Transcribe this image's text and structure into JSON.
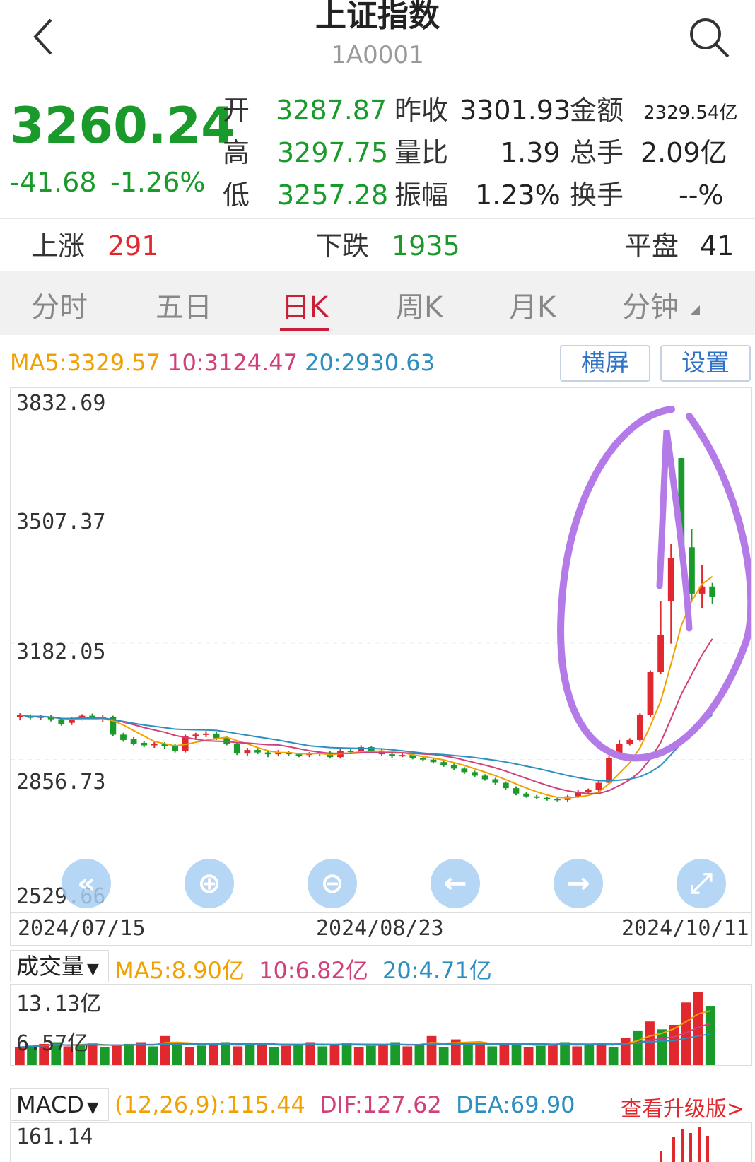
{
  "header": {
    "title": "上证指数",
    "code": "1A0001",
    "back_icon": "chevron-left-icon",
    "search_icon": "search-icon"
  },
  "quote": {
    "price": "3260.24",
    "change": "-41.68",
    "change_pct": "-1.26%",
    "open_label": "开",
    "open": "3287.87",
    "high_label": "高",
    "high": "3297.75",
    "low_label": "低",
    "low": "3257.28",
    "prev_close_label": "昨收",
    "prev_close": "3301.93",
    "vol_ratio_label": "量比",
    "vol_ratio": "1.39",
    "amplitude_label": "振幅",
    "amplitude": "1.23%",
    "amount_label": "金额",
    "amount": "2329.54亿",
    "total_hand_label": "总手",
    "total_hand": "2.09亿",
    "turnover_label": "换手",
    "turnover": "--%"
  },
  "breadth": {
    "up_label": "上涨",
    "up": "291",
    "down_label": "下跌",
    "down": "1935",
    "flat_label": "平盘",
    "flat": "41"
  },
  "tabs": [
    {
      "label": "分时"
    },
    {
      "label": "五日"
    },
    {
      "label": "日K"
    },
    {
      "label": "周K"
    },
    {
      "label": "月K"
    },
    {
      "label": "分钟"
    }
  ],
  "active_tab": "日K",
  "ma": {
    "ma5": "MA5:3329.57",
    "ma10": "10:3124.47",
    "ma20": "20:2930.63"
  },
  "buttons": {
    "landscape": "横屏",
    "settings": "设置"
  },
  "price_axis": [
    "3832.69",
    "3507.37",
    "3182.05",
    "2856.73",
    "2529.66"
  ],
  "date_axis": [
    "2024/07/15",
    "2024/08/23",
    "2024/10/11"
  ],
  "volume": {
    "selector": "成交量",
    "ma5": "MA5:8.90亿",
    "ma10": "10:6.82亿",
    "ma20": "20:4.71亿",
    "axis": [
      "13.13亿",
      "6.57亿"
    ]
  },
  "macd": {
    "selector": "MACD",
    "params": "(12,26,9):115.44",
    "dif": "DIF:127.62",
    "dea": "DEA:69.90",
    "upgrade_link": "查看升级版>",
    "axis_top": "161.14"
  },
  "colors": {
    "up": "#e0282e",
    "down": "#1a9a2a",
    "ma5": "#f0a000",
    "ma10": "#d0407a",
    "ma20": "#2c8fc0",
    "annotation": "#b47be8"
  },
  "chart_data": {
    "type": "candlestick",
    "ylim": [
      2529.66,
      3832.69
    ],
    "candles": [
      [
        2975,
        2980,
        2965,
        2985
      ],
      [
        2978,
        2972,
        2968,
        2982
      ],
      [
        2972,
        2976,
        2966,
        2980
      ],
      [
        2976,
        2968,
        2962,
        2980
      ],
      [
        2968,
        2955,
        2950,
        2972
      ],
      [
        2958,
        2970,
        2952,
        2974
      ],
      [
        2970,
        2978,
        2965,
        2982
      ],
      [
        2978,
        2972,
        2966,
        2984
      ],
      [
        2972,
        2975,
        2960,
        2980
      ],
      [
        2975,
        2925,
        2920,
        2978
      ],
      [
        2925,
        2910,
        2905,
        2930
      ],
      [
        2912,
        2900,
        2895,
        2918
      ],
      [
        2902,
        2895,
        2890,
        2908
      ],
      [
        2895,
        2900,
        2888,
        2906
      ],
      [
        2900,
        2893,
        2886,
        2904
      ],
      [
        2893,
        2880,
        2875,
        2898
      ],
      [
        2880,
        2920,
        2875,
        2925
      ],
      [
        2920,
        2925,
        2910,
        2930
      ],
      [
        2925,
        2928,
        2918,
        2935
      ],
      [
        2928,
        2915,
        2910,
        2932
      ],
      [
        2915,
        2900,
        2895,
        2920
      ],
      [
        2900,
        2872,
        2868,
        2905
      ],
      [
        2872,
        2882,
        2866,
        2888
      ],
      [
        2882,
        2875,
        2870,
        2888
      ],
      [
        2875,
        2870,
        2862,
        2880
      ],
      [
        2870,
        2876,
        2864,
        2882
      ],
      [
        2876,
        2870,
        2866,
        2880
      ],
      [
        2870,
        2868,
        2862,
        2874
      ],
      [
        2868,
        2872,
        2862,
        2876
      ],
      [
        2872,
        2875,
        2866,
        2880
      ],
      [
        2875,
        2862,
        2858,
        2880
      ],
      [
        2862,
        2880,
        2858,
        2886
      ],
      [
        2880,
        2877,
        2872,
        2884
      ],
      [
        2877,
        2890,
        2874,
        2895
      ],
      [
        2890,
        2880,
        2876,
        2894
      ],
      [
        2880,
        2870,
        2865,
        2884
      ],
      [
        2870,
        2865,
        2860,
        2874
      ],
      [
        2865,
        2868,
        2862,
        2872
      ],
      [
        2868,
        2860,
        2856,
        2872
      ],
      [
        2860,
        2855,
        2850,
        2864
      ],
      [
        2855,
        2848,
        2844,
        2860
      ],
      [
        2848,
        2840,
        2835,
        2852
      ],
      [
        2840,
        2830,
        2825,
        2844
      ],
      [
        2830,
        2820,
        2815,
        2834
      ],
      [
        2820,
        2810,
        2805,
        2824
      ],
      [
        2810,
        2800,
        2796,
        2814
      ],
      [
        2800,
        2790,
        2785,
        2804
      ],
      [
        2790,
        2775,
        2770,
        2794
      ],
      [
        2775,
        2760,
        2755,
        2780
      ],
      [
        2760,
        2752,
        2748,
        2764
      ],
      [
        2752,
        2748,
        2744,
        2756
      ],
      [
        2748,
        2745,
        2740,
        2752
      ],
      [
        2745,
        2742,
        2738,
        2750
      ],
      [
        2742,
        2752,
        2736,
        2756
      ],
      [
        2752,
        2765,
        2748,
        2770
      ],
      [
        2765,
        2770,
        2760,
        2774
      ],
      [
        2770,
        2790,
        2766,
        2794
      ],
      [
        2790,
        2860,
        2786,
        2864
      ],
      [
        2860,
        2900,
        2855,
        2910
      ],
      [
        2900,
        2910,
        2895,
        2915
      ],
      [
        2910,
        2980,
        2905,
        2985
      ],
      [
        2980,
        3100,
        2975,
        3105
      ],
      [
        3100,
        3205,
        3095,
        3300
      ],
      [
        3300,
        3420,
        3180,
        3460
      ],
      [
        3700,
        3450,
        3420,
        3700
      ],
      [
        3450,
        3320,
        3300,
        3500
      ],
      [
        3320,
        3340,
        3280,
        3400
      ],
      [
        3340,
        3310,
        3290,
        3350
      ]
    ],
    "volume_ylim": [
      0,
      13.13
    ],
    "macd_axis_top": 161.14
  }
}
